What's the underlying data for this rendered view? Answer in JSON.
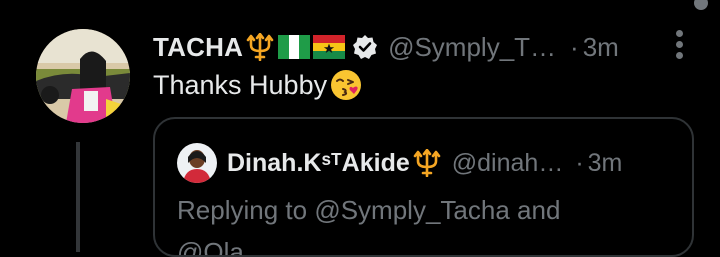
{
  "tweet": {
    "display_name": "TACHA",
    "name_emojis": [
      "trident-emoji",
      "nigeria-flag-emoji",
      "ghana-flag-emoji"
    ],
    "verified": true,
    "handle": "@Symply_T…",
    "separator": "·",
    "time": "3m",
    "text": "Thanks Hubby",
    "text_emoji": "kissing-face-emoji"
  },
  "quote": {
    "display_name": "Dinah.KˢᵀAkide",
    "name_emojis": [
      "trident-emoji"
    ],
    "handle": "@dinah…",
    "separator": "·",
    "time": "3m",
    "replying_prefix": "Replying to ",
    "replying_mention": "@Symply_Tacha",
    "replying_suffix": " and",
    "replying_line2": "@Ola..."
  },
  "colors": {
    "background": "#000000",
    "primary_text": "#e7e9ea",
    "secondary_text": "#71767b",
    "border": "#2f3336",
    "trident": "#f5a623",
    "verified_badge": "#e7e9ea"
  }
}
